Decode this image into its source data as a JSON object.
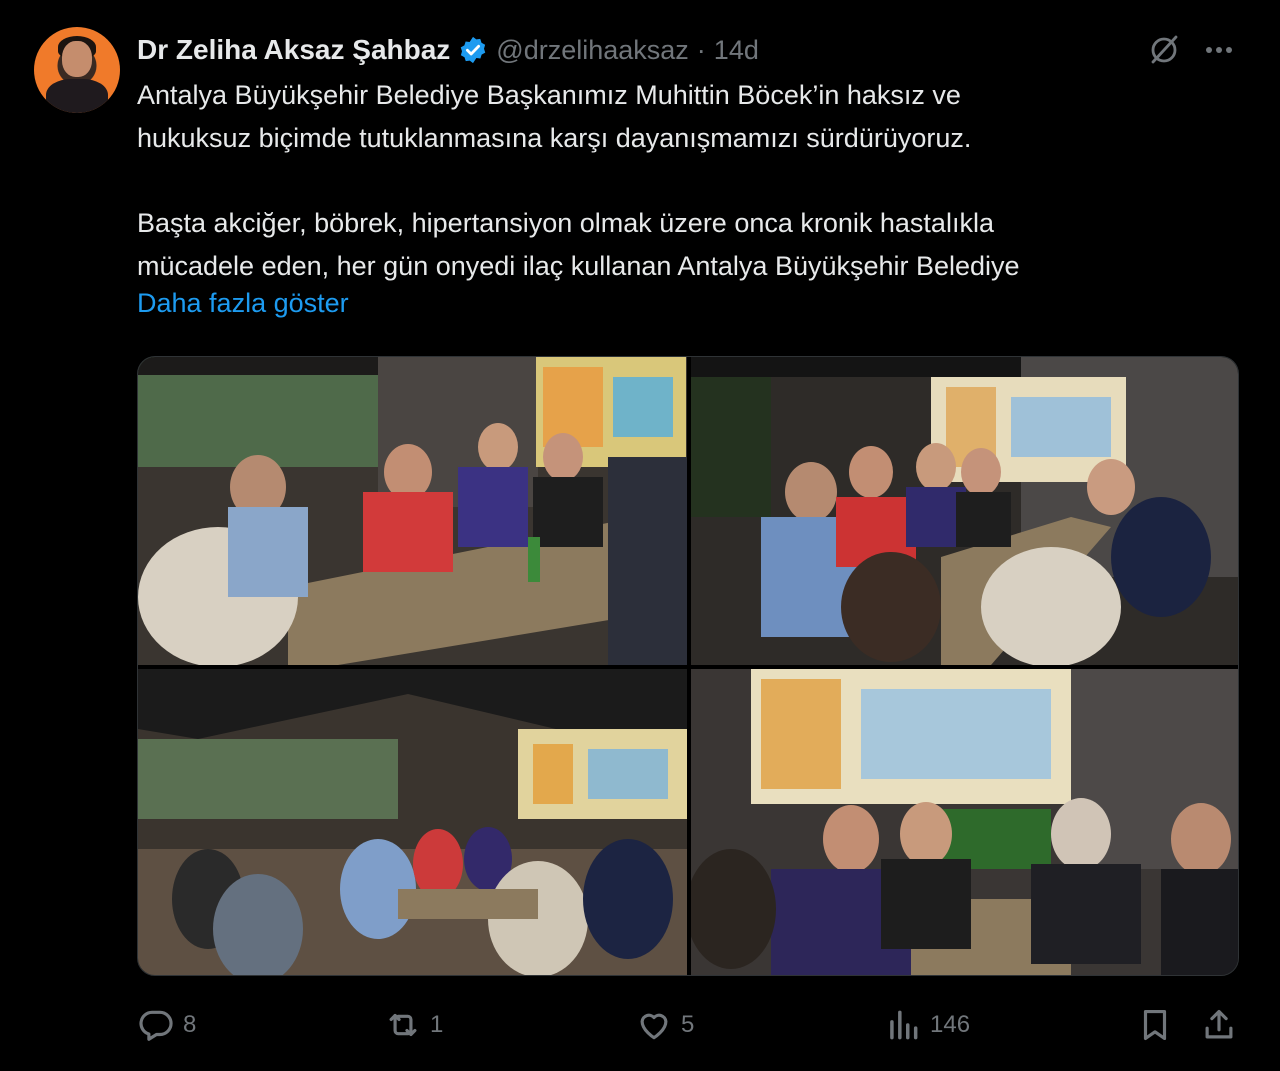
{
  "tweet": {
    "author_name": "Dr Zeliha Aksaz Şahbaz",
    "handle": "@drzelihaaksaz",
    "separator": "·",
    "time": "14d",
    "text_lines": [
      "Antalya Büyükşehir Belediye Başkanımız Muhittin Böcek’in haksız ve",
      "hukuksuz biçimde tutuklanmasına karşı dayanışmamızı sürdürüyoruz.",
      "Başta akciğer, böbrek, hipertansiyon olmak üzere onca kronik hastalıkla",
      "mücadele eden, her gün onyedi ilaç kullanan Antalya Büyükşehir Belediye"
    ],
    "show_more": "Daha fazla göster"
  },
  "actions": {
    "replies": "8",
    "reposts": "1",
    "likes": "5",
    "views": "146"
  },
  "icons": {
    "verified": "verified-badge-icon",
    "grok": "grok-icon",
    "more": "more-icon",
    "reply": "reply-icon",
    "repost": "repost-icon",
    "like": "like-icon",
    "views": "views-icon",
    "bookmark": "bookmark-icon",
    "share": "share-icon"
  },
  "colors": {
    "background": "#000000",
    "text": "#e7e9ea",
    "muted": "#71767b",
    "link": "#1d9bf0",
    "verified": "#1d9bf0"
  }
}
